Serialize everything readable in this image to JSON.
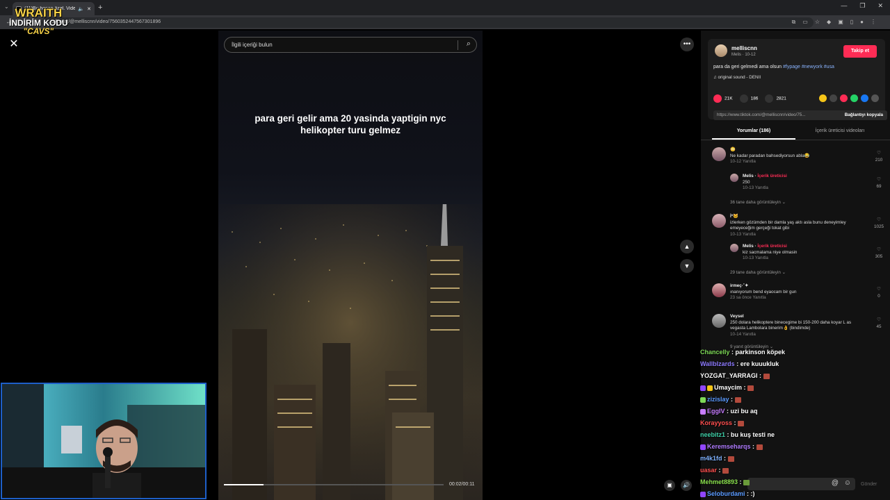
{
  "browser": {
    "tab_title": "(11)Bu hesap özel. Videolar",
    "url": "...tok.com/@melliscnn/video/7560352447567301896"
  },
  "overlay": {
    "line1": "WRAITH",
    "line2": "İNDİRİM KODU",
    "line3": "\"CAVS\""
  },
  "search": {
    "placeholder": "İlgili içeriği bulun"
  },
  "video": {
    "caption_line1": "para geri gelir ama 20 yasinda yaptigin nyc",
    "caption_line2": "helikopter turu gelmez",
    "time": "00:02/00:11",
    "progress": 0.18
  },
  "author": {
    "name": "melliscnn",
    "meta": "Melis · 10-12",
    "follow_label": "Takip et",
    "desc_text": "para da geri gelmedi ama olsun ",
    "desc_tags": "#fypage #newyork #usa",
    "sound": "♫  original sound - DENII"
  },
  "stats": {
    "likes": "21K",
    "comments": "186",
    "saves": "2821"
  },
  "link": {
    "url": "https://www.tiktok.com/@melliscnn/video/75...",
    "copy_label": "Bağlantıyı kopyala"
  },
  "tabs": {
    "comments": "Yorumlar (186)",
    "creator_videos": "İçerik üreticisi videoları"
  },
  "comments": [
    {
      "author": "😳",
      "text": "Ne kadar paradan bahsediyorsun abla😂",
      "meta": "10-12      Yanıtla",
      "likes": "210"
    },
    {
      "author": "Melis · ",
      "creator": "İçerik üreticisi",
      "text": "250",
      "meta": "10-13      Yanıtla",
      "likes": "69"
    },
    {
      "more": "36 tane daha görüntüleyin ⌄"
    },
    {
      "author": " İ*🐱",
      "text": "izlerken gözümden bir damla yaş aktı asla bunu deneyimley emeyeceğim gerçeği tokat gibi",
      "meta": "10-13      Yanıtla",
      "likes": "1025"
    },
    {
      "author": "Melis · ",
      "creator": "İçerik üreticisi",
      "text": "kiz sacmalama niye olmasin",
      "meta": "10-13      Yanıtla",
      "likes": "305"
    },
    {
      "more": "29 tane daha görüntüleyin ⌄"
    },
    {
      "author": "irmeç·˚✦",
      "text": "ınanıyorum bend eyaocam bir gun",
      "meta": "23 sa önce      Yanıtla",
      "likes": "0"
    },
    {
      "author": "Veysel",
      "text": "250 dolara helikoptere binecegime bi 150-200 daha koyar L as vegasta Lambolara binerim👌 (bindimde)",
      "meta": "10-14      Yanıtla",
      "likes": "45"
    },
    {
      "more": "9 yanıt görüntüleyin ⌄"
    }
  ],
  "chat": [
    {
      "user": "Chancelly",
      "color": "#7ed957",
      "msg": "parkinson köpek"
    },
    {
      "user": "Wallblzards",
      "color": "#8e7bff",
      "msg": "ere kuuukluk"
    },
    {
      "user": "YOZGAT_YARRAGI",
      "color": "#ffffff",
      "msg": ""
    },
    {
      "user": "Umaycim",
      "color": "#ffffff",
      "msg": ""
    },
    {
      "user": "zizislay",
      "color": "#5b9bff",
      "msg": ""
    },
    {
      "user": "EggIV",
      "color": "#c77dff",
      "msg": "uzi bu aq"
    },
    {
      "user": "Korayyoss",
      "color": "#ff4f4f",
      "msg": ""
    },
    {
      "user": "neebitz1",
      "color": "#3fd0a8",
      "msg": "bu kuş testi ne"
    },
    {
      "user": "Keremseharqs",
      "color": "#b07cff",
      "msg": ""
    },
    {
      "user": "m4k1fd",
      "color": "#7fb2ff",
      "msg": ""
    },
    {
      "user": "uasar",
      "color": "#ff4f4f",
      "msg": ""
    },
    {
      "user": "Mehmet8893",
      "color": "#8be04e",
      "msg": ""
    },
    {
      "user": "Seloburdami",
      "color": "#5b9bff",
      "msg": ":)"
    }
  ],
  "send_label": "Gönder"
}
